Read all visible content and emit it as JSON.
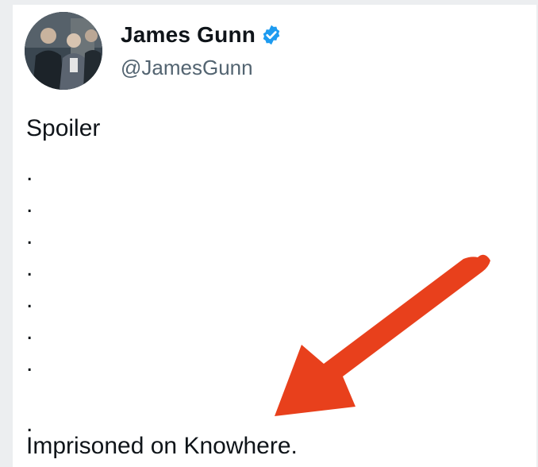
{
  "tweet": {
    "author": {
      "display_name": "James Gunn",
      "handle": "@JamesGunn",
      "verified": true,
      "verified_icon": "verified-badge-icon",
      "verified_color": "#1d9bf0"
    },
    "lines": [
      "Spoiler",
      ".",
      ".",
      ".",
      ".",
      ".",
      ".",
      ".",
      ".",
      "Imprisoned on Knowhere."
    ]
  },
  "annotation": {
    "arrow_color": "#e8401c",
    "arrow_icon": "red-arrow-icon"
  }
}
